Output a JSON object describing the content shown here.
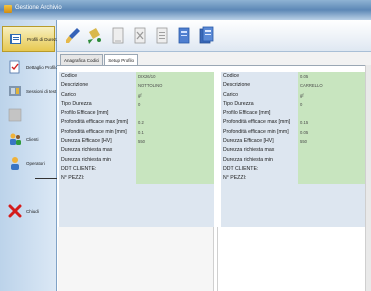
{
  "window": {
    "title": "Gestione Archivio"
  },
  "sidebar": {
    "items": [
      {
        "label": "Profili di Durezza",
        "icon": "book-icon"
      },
      {
        "label": "Dettaglio Profilo",
        "icon": "document-check-icon"
      },
      {
        "label": "Sessioni di test",
        "icon": "tools-icon"
      },
      {
        "label": "",
        "icon": "blank-icon"
      },
      {
        "label": "Clienti",
        "icon": "people-icon"
      },
      {
        "label": "Operatori",
        "icon": "operator-icon"
      },
      {
        "label": "Chiudi",
        "icon": "close-x-icon"
      }
    ]
  },
  "toolbar": {
    "buttons": [
      {
        "icon": "brush-icon"
      },
      {
        "icon": "paint-bucket-icon"
      },
      {
        "icon": "document-icon"
      },
      {
        "icon": "document-delete-icon"
      },
      {
        "icon": "document-lines-icon"
      },
      {
        "icon": "blue-document-icon"
      },
      {
        "icon": "blue-document-stack-icon"
      }
    ]
  },
  "tabs": [
    {
      "label": "Anagrafica Codici"
    },
    {
      "label": "Setup Profilo"
    }
  ],
  "panels": [
    {
      "rows": [
        {
          "label": "Codice",
          "value": "DIX26/10"
        },
        {
          "label": "Descrizione",
          "value": "NOTTOLINO"
        },
        {
          "label": "Carico",
          "value": "gf"
        },
        {
          "label": "Tipo Durezza",
          "value": "0"
        },
        {
          "label": "Profilo Efficace [mm]",
          "value": ""
        },
        {
          "label": "Profondità efficace max [mm]",
          "value": "0.2"
        },
        {
          "label": "Profondità efficace min [mm]",
          "value": "0.1"
        },
        {
          "label": "Durezza Efficace [HV]",
          "value": "550"
        },
        {
          "label": "Durezza richiesta max",
          "value": ""
        },
        {
          "label": "Durezza richiesta min",
          "value": ""
        },
        {
          "label": "DDT CLIENTE:",
          "value": ""
        },
        {
          "label": "N° PEZZI:",
          "value": ""
        }
      ]
    },
    {
      "rows": [
        {
          "label": "Codice",
          "value": "0.05"
        },
        {
          "label": "Descrizione",
          "value": "CARRELLO"
        },
        {
          "label": "Carico",
          "value": "gf"
        },
        {
          "label": "Tipo Durezza",
          "value": "0"
        },
        {
          "label": "Profilo Efficace [mm]",
          "value": ""
        },
        {
          "label": "Profondità efficace max [mm]",
          "value": "0.15"
        },
        {
          "label": "Profondità efficace min [mm]",
          "value": "0.05"
        },
        {
          "label": "Durezza Efficace [HV]",
          "value": "550"
        },
        {
          "label": "Durezza richiesta max",
          "value": ""
        },
        {
          "label": "Durezza richiesta min",
          "value": ""
        },
        {
          "label": "DDT CLIENTE:",
          "value": ""
        },
        {
          "label": "N° PEZZI:",
          "value": ""
        }
      ]
    }
  ]
}
